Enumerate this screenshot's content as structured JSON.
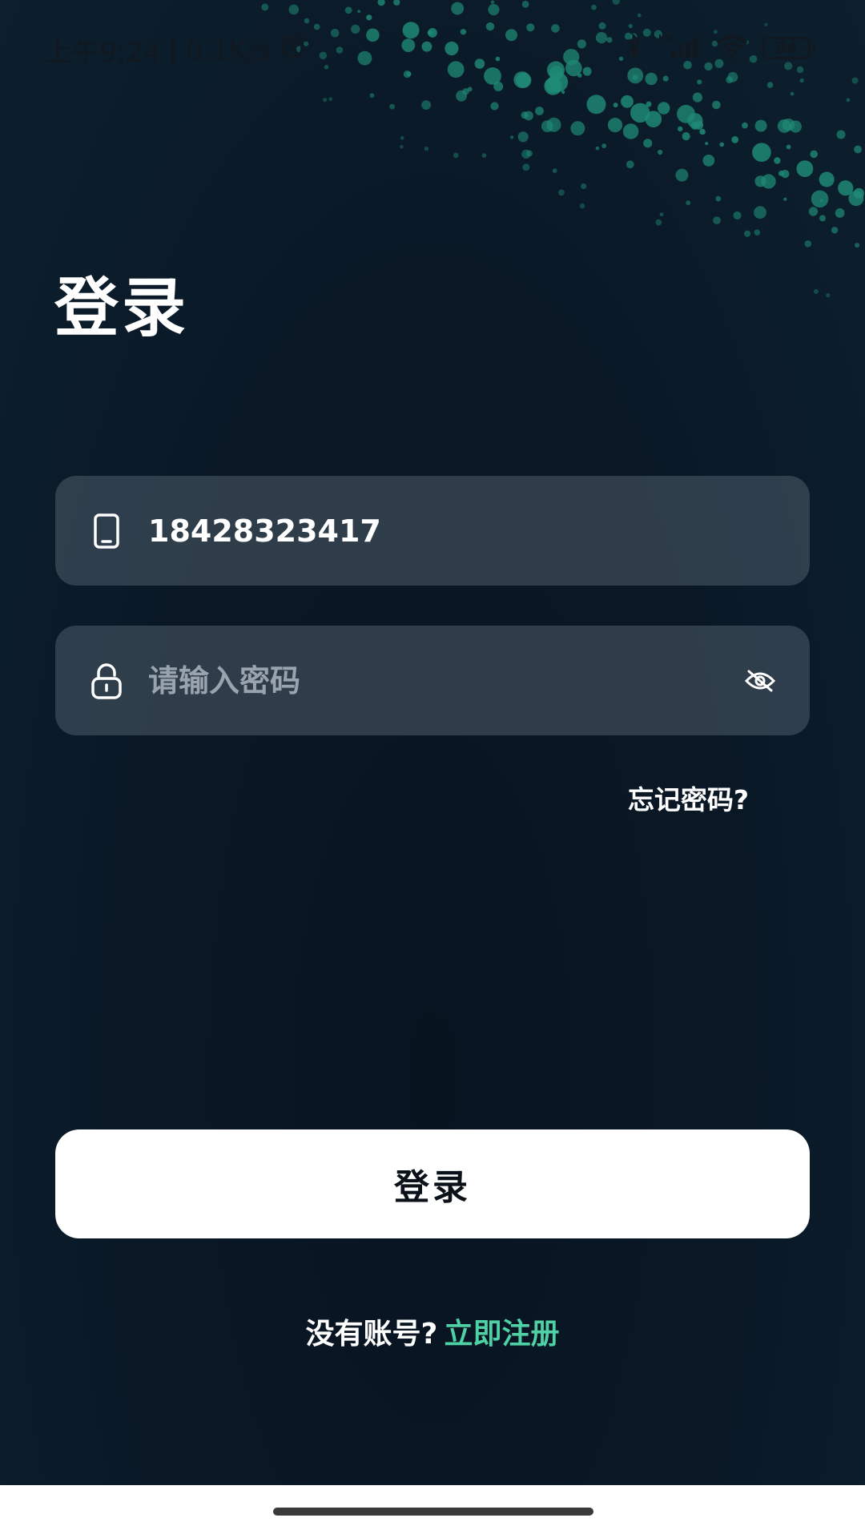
{
  "status_bar": {
    "time": "上午9:24",
    "network_speed": "0.1K/s",
    "battery_level": "94",
    "icons": [
      "alarm-icon",
      "bluetooth-icon",
      "hd-signal-icon",
      "wifi-icon",
      "battery-icon"
    ]
  },
  "page": {
    "title": "登录"
  },
  "form": {
    "phone": {
      "value": "18428323417",
      "icon": "phone-icon"
    },
    "password": {
      "value": "",
      "placeholder": "请输入密码",
      "icon": "lock-icon",
      "toggle_icon": "eye-off-icon"
    },
    "forgot_label": "忘记密码?",
    "submit_label": "登录"
  },
  "register": {
    "prompt": "没有账号?",
    "link_label": "立即注册"
  },
  "colors": {
    "background": "#0a1826",
    "accent": "#4fd1a6",
    "field_bg": "#3a4856",
    "button_bg": "#ffffff"
  }
}
